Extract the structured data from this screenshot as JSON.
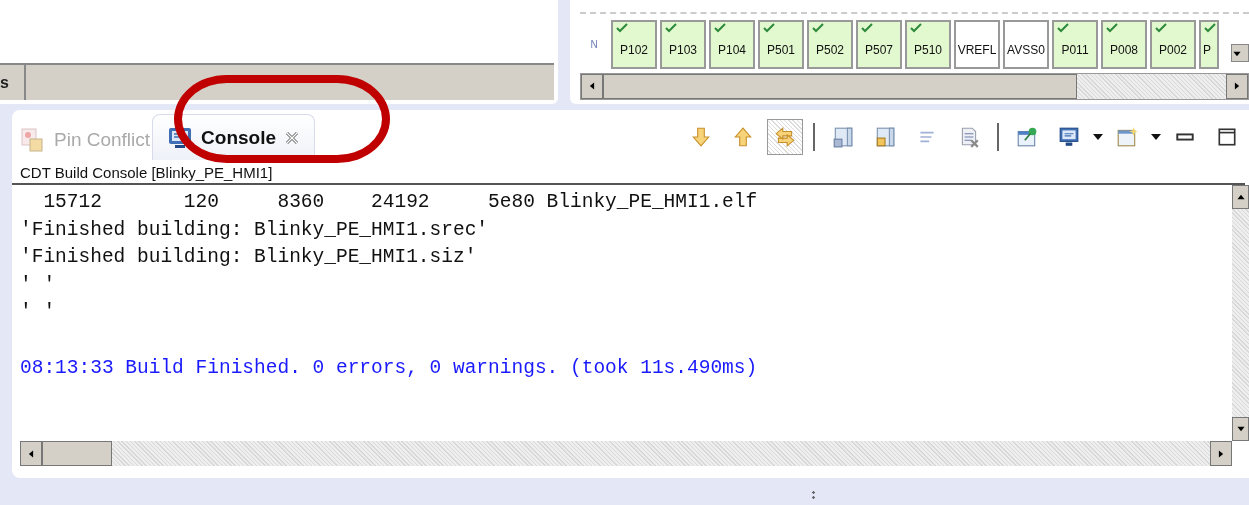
{
  "left_panel": {
    "tab_text": "s"
  },
  "pin_panel": {
    "row_label": "N",
    "pins": [
      {
        "label": "P102",
        "checked": true
      },
      {
        "label": "P103",
        "checked": true
      },
      {
        "label": "P104",
        "checked": true
      },
      {
        "label": "P501",
        "checked": true
      },
      {
        "label": "P502",
        "checked": true
      },
      {
        "label": "P507",
        "checked": true
      },
      {
        "label": "P510",
        "checked": true
      },
      {
        "label": "VREFL",
        "checked": false
      },
      {
        "label": "AVSS0",
        "checked": false
      },
      {
        "label": "P011",
        "checked": true
      },
      {
        "label": "P008",
        "checked": true
      },
      {
        "label": "P002",
        "checked": true
      },
      {
        "label": "P",
        "checked": true
      }
    ]
  },
  "tabs": [
    {
      "label": "Pin Conflict",
      "selected": false,
      "closable": false
    },
    {
      "label": "Console",
      "selected": true,
      "closable": true
    }
  ],
  "toolbar": [
    {
      "pressed": false
    },
    {
      "pressed": false
    },
    {
      "pressed": true
    },
    {
      "pressed": false
    },
    {
      "pressed": false
    },
    {
      "pressed": false
    },
    {
      "pressed": false
    },
    {
      "pressed": false
    },
    {
      "pressed": false
    },
    {
      "pressed": false
    },
    {
      "pressed": false
    },
    {
      "pressed": false
    }
  ],
  "console": {
    "title": "CDT Build Console [Blinky_PE_HMI1]",
    "lines": [
      {
        "kind": "output",
        "text": "  15712       120     8360    24192     5e80 Blinky_PE_HMI1.elf"
      },
      {
        "kind": "output",
        "text": "'Finished building: Blinky_PE_HMI1.srec'"
      },
      {
        "kind": "output",
        "text": "'Finished building: Blinky_PE_HMI1.siz'"
      },
      {
        "kind": "output",
        "text": "' '"
      },
      {
        "kind": "output",
        "text": "' '"
      },
      {
        "kind": "status",
        "text": "08:13:33 Build Finished. 0 errors, 0 warnings. (took 11s.490ms)"
      }
    ]
  }
}
